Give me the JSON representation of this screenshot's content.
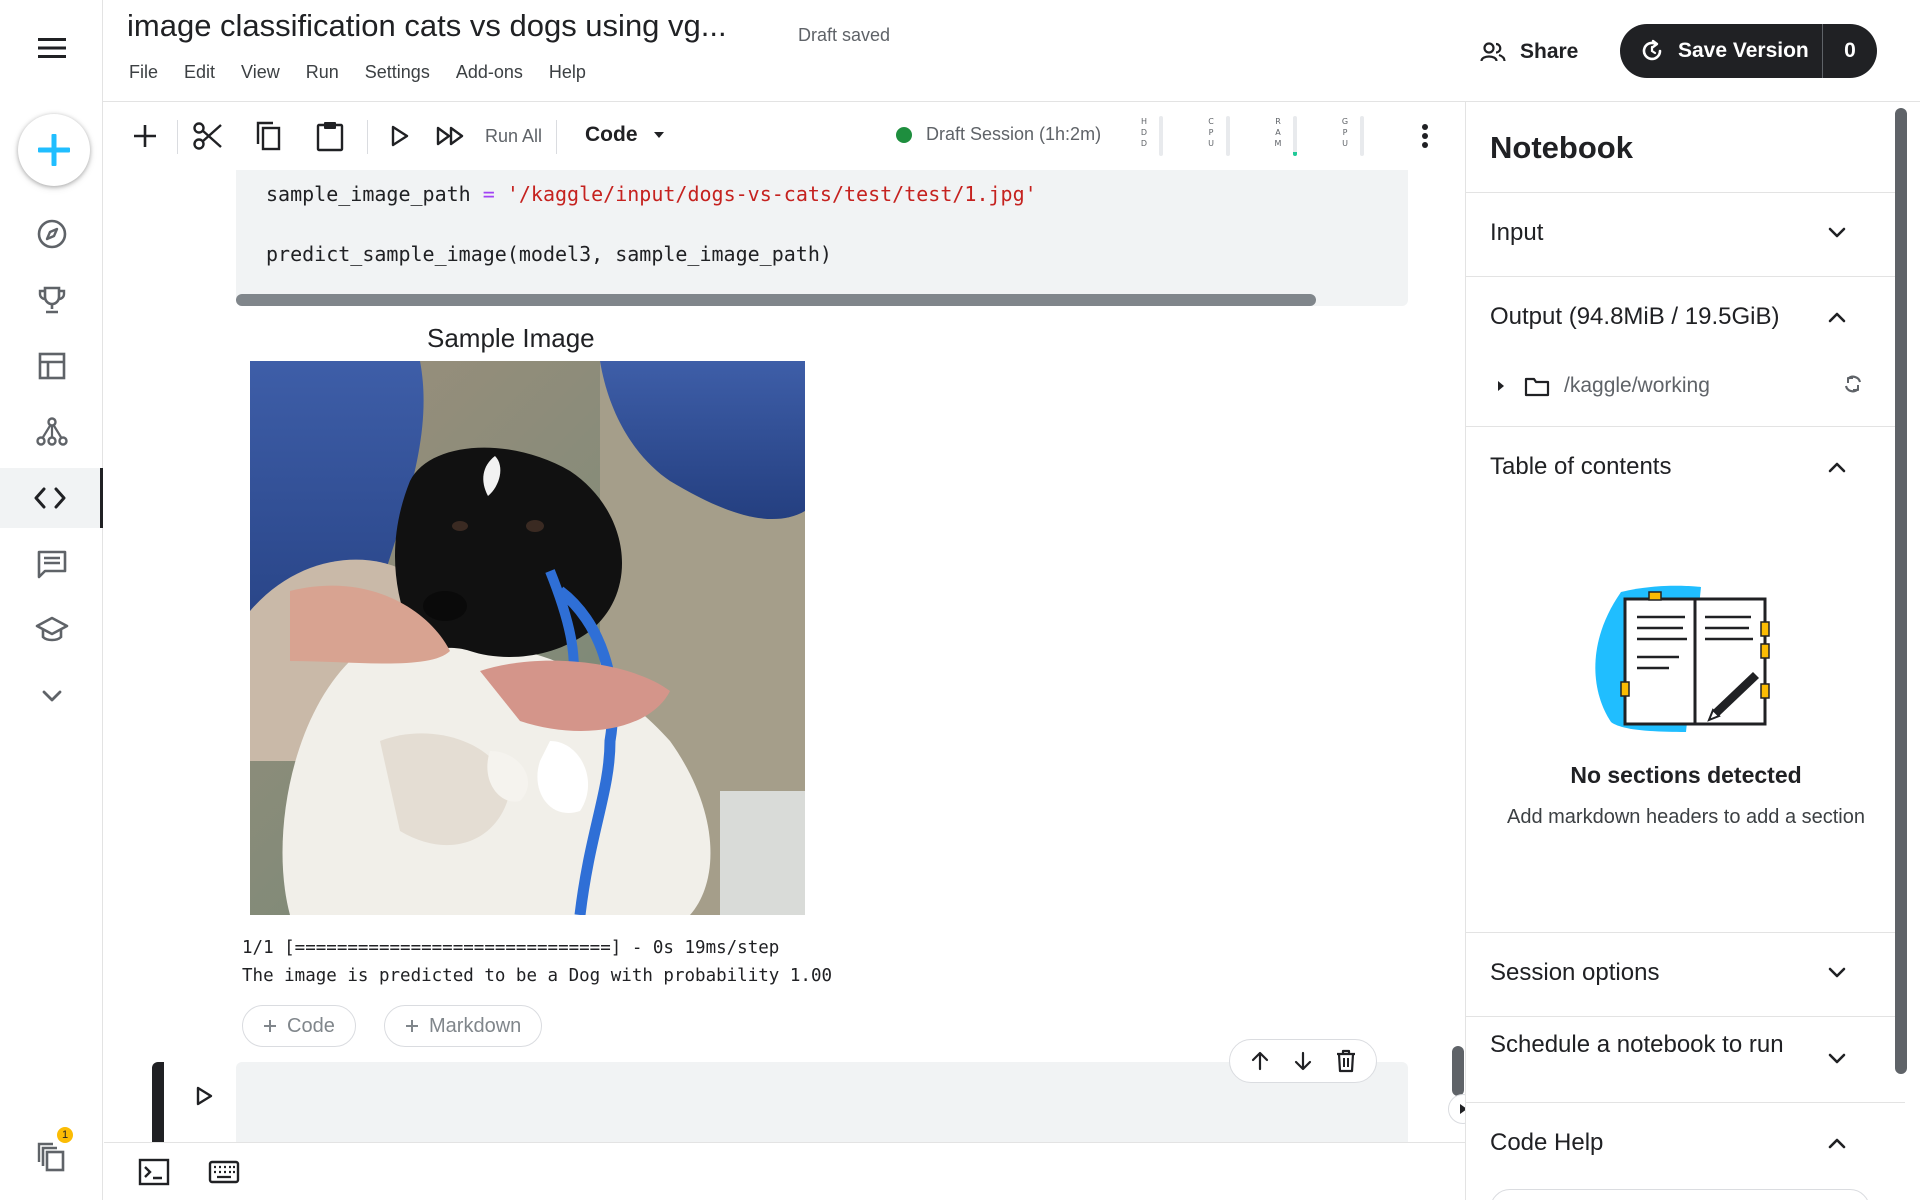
{
  "header": {
    "title": "image classification cats vs dogs using vg...",
    "save_status": "Draft saved",
    "menu": [
      "File",
      "Edit",
      "View",
      "Run",
      "Settings",
      "Add-ons",
      "Help"
    ],
    "share_label": "Share",
    "save_version_label": "Save Version",
    "save_version_count": "0"
  },
  "rail": {
    "items": [
      "create-icon",
      "compass-icon",
      "trophy-icon",
      "table-icon",
      "models-icon",
      "code-icon",
      "comments-icon",
      "learn-icon",
      "chevron-down-icon",
      "copies-icon"
    ],
    "active": "code-icon",
    "notification_badge": "1"
  },
  "toolbar": {
    "run_all_label": "Run All",
    "cell_type": "Code",
    "session_status": "Draft Session (1h:2m)",
    "session_status_color": "#1e8e3e",
    "meters": [
      {
        "name": "HDD",
        "letters": [
          "H",
          "D",
          "D"
        ],
        "level": 0.0
      },
      {
        "name": "CPU",
        "letters": [
          "C",
          "P",
          "U"
        ],
        "level": 0.0
      },
      {
        "name": "RAM",
        "letters": [
          "R",
          "A",
          "M"
        ],
        "level": 0.1
      },
      {
        "name": "GPU",
        "letters": [
          "G",
          "P",
          "U"
        ],
        "level": 0.0
      }
    ]
  },
  "notebook": {
    "code_lines": [
      {
        "parts": [
          {
            "t": "sample_image_path ",
            "c": ""
          },
          {
            "t": "=",
            "c": "op"
          },
          {
            "t": " ",
            "c": ""
          },
          {
            "t": "'/kaggle/input/dogs-vs-cats/test/test/1.jpg'",
            "c": "str"
          }
        ]
      },
      {
        "parts": [
          {
            "t": "predict_sample_image(model3, sample_image_path)",
            "c": ""
          }
        ]
      }
    ],
    "output_image_title": "Sample Image",
    "output_lines": [
      "1/1 [==============================] - 0s 19ms/step",
      "The image is predicted to be a Dog with probability 1.00"
    ],
    "add_code_label": "Code",
    "add_markdown_label": "Markdown"
  },
  "panel": {
    "heading": "Notebook",
    "sections": [
      {
        "title": "Input",
        "expanded": false
      },
      {
        "title": "Output (94.8MiB / 19.5GiB)",
        "expanded": true
      },
      {
        "title": "Table of contents",
        "expanded": true
      },
      {
        "title": "Session options",
        "expanded": false
      },
      {
        "title": "Schedule a notebook to run",
        "expanded": false
      },
      {
        "title": "Code Help",
        "expanded": true
      }
    ],
    "output_folder": "/kaggle/working",
    "toc_empty_title": "No sections detected",
    "toc_empty_subtitle": "Add markdown headers to add a section"
  },
  "colors": {
    "accent": "#20beff",
    "dark": "#202124"
  }
}
